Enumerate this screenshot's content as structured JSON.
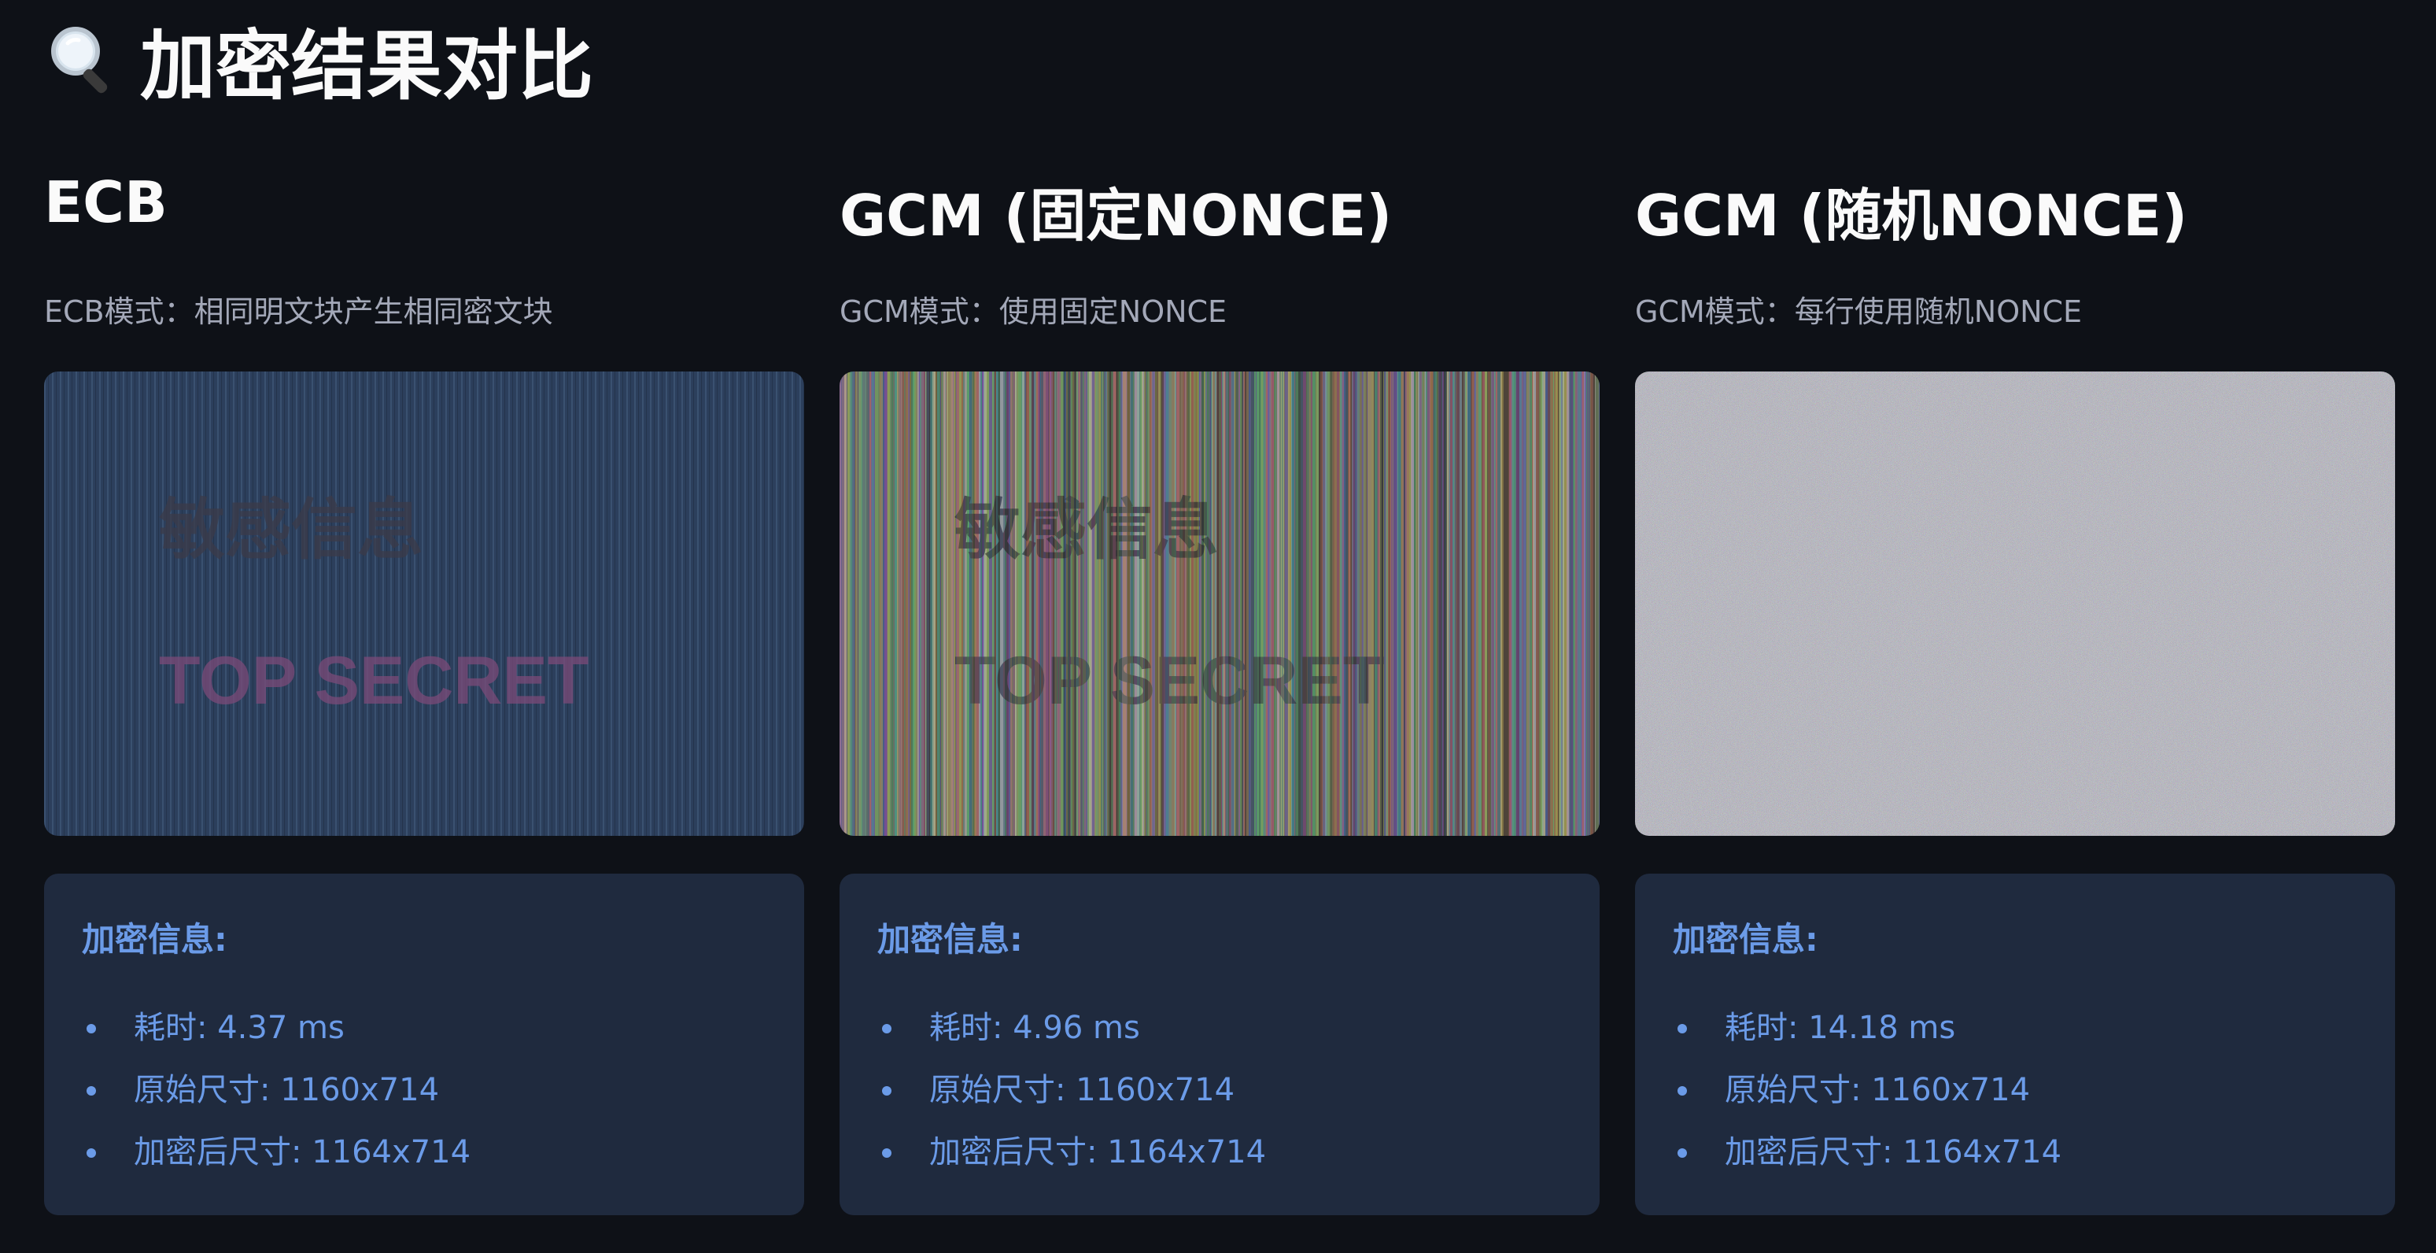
{
  "header": {
    "icon": "magnifier-icon",
    "title": "加密结果对比"
  },
  "panels": [
    {
      "mode": "ECB",
      "description": "ECB模式：相同明文块产生相同密文块",
      "image": {
        "line1": "敏感信息",
        "line2": "TOP SECRET",
        "style": "stripes-muted",
        "colors": {
          "base": "#2c3f5c",
          "text1": "#3a3a48",
          "text2": "#7a4a78"
        }
      },
      "info": {
        "title": "加密信息:",
        "items": [
          {
            "label": "耗时",
            "value": "4.37 ms"
          },
          {
            "label": "原始尺寸",
            "value": "1160x714"
          },
          {
            "label": "加密后尺寸",
            "value": "1164x714"
          }
        ]
      }
    },
    {
      "mode": "GCM (固定NONCE)",
      "description": "GCM模式：使用固定NONCE",
      "image": {
        "line1": "敏感信息",
        "line2": "TOP SECRET",
        "style": "stripes-colorful",
        "colors": {
          "base": "#3a3a3a",
          "text1": "#2e2e34",
          "text2": "#3a3a40"
        }
      },
      "info": {
        "title": "加密信息:",
        "items": [
          {
            "label": "耗时",
            "value": "4.96 ms"
          },
          {
            "label": "原始尺寸",
            "value": "1160x714"
          },
          {
            "label": "加密后尺寸",
            "value": "1164x714"
          }
        ]
      }
    },
    {
      "mode": "GCM (随机NONCE)",
      "description": "GCM模式：每行使用随机NONCE",
      "image": {
        "line1": "",
        "line2": "",
        "style": "noise",
        "colors": {
          "base": "#4a4a4c"
        }
      },
      "info": {
        "title": "加密信息:",
        "items": [
          {
            "label": "耗时",
            "value": "14.18 ms"
          },
          {
            "label": "原始尺寸",
            "value": "1160x714"
          },
          {
            "label": "加密后尺寸",
            "value": "1164x714"
          }
        ]
      }
    }
  ],
  "theme": {
    "background": "#0e1117",
    "panel": "#1f2a3e",
    "accent": "#6b9be8",
    "text": "#fafafa",
    "muted": "#a3a8b8"
  }
}
